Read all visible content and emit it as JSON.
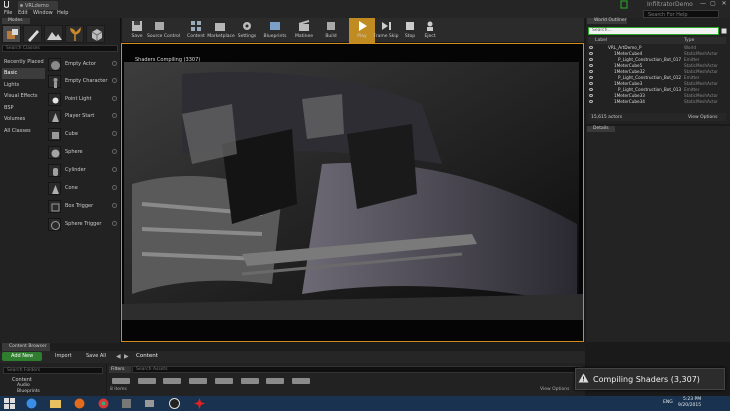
{
  "window": {
    "tab_label": "VRLdemo",
    "project_name": "InfiltratorDemo",
    "buttons": [
      "—",
      "▢",
      "✕"
    ]
  },
  "menu": {
    "items": [
      "File",
      "Edit",
      "Window",
      "Help"
    ],
    "search_help_placeholder": "Search For Help"
  },
  "modes": {
    "tab_label": "Modes",
    "search_placeholder": "Search Classes",
    "categories": [
      "Recently Placed",
      "Basic",
      "Lights",
      "Visual Effects",
      "BSP",
      "Volumes",
      "All Classes"
    ],
    "active_category": "Basic",
    "placeables": [
      "Empty Actor",
      "Empty Character",
      "Point Light",
      "Player Start",
      "Cube",
      "Sphere",
      "Cylinder",
      "Cone",
      "Box Trigger",
      "Sphere Trigger"
    ]
  },
  "toolbar": {
    "buttons": [
      "Save",
      "Source Control",
      "Content",
      "Marketplace",
      "Settings",
      "Blueprints",
      "Matinee",
      "Build",
      "Play",
      "Frame Skip",
      "Stop",
      "Eject"
    ]
  },
  "viewport": {
    "banner": "Shaders Compiling (3307)"
  },
  "outliner": {
    "tab_label": "World Outliner",
    "search_placeholder": "Search...",
    "col_label": "Label",
    "col_type": "Type",
    "rows": [
      {
        "name": "VRL_ArtDemo_P",
        "type": "World"
      },
      {
        "name": "1MeterCube4",
        "type": "StaticMeshActor"
      },
      {
        "name": "P_Light_Construction_Bot_017",
        "type": "Emitter"
      },
      {
        "name": "1MeterCube5",
        "type": "StaticMeshActor"
      },
      {
        "name": "1MeterCube32",
        "type": "StaticMeshActor"
      },
      {
        "name": "P_Light_Construction_Bot_012",
        "type": "Emitter"
      },
      {
        "name": "1MeterCube3",
        "type": "StaticMeshActor"
      },
      {
        "name": "P_Light_Construction_Bot_013",
        "type": "Emitter"
      },
      {
        "name": "1MeterCube33",
        "type": "StaticMeshActor"
      },
      {
        "name": "1MeterCube34",
        "type": "StaticMeshActor"
      }
    ],
    "actor_count": "15,615 actors",
    "view_options": "View Options"
  },
  "details": {
    "tab_label": "Details"
  },
  "content_browser": {
    "tab_label": "Content Browser",
    "add_new": "Add New",
    "import": "Import",
    "save_all": "Save All",
    "path": "Content",
    "search_folders_placeholder": "Search Folders",
    "tree": [
      "Content",
      "Audio",
      "Blueprints"
    ],
    "filters": "Filters",
    "search_assets_placeholder": "Search Assets",
    "items_count": "8 items",
    "view_options": "View Options"
  },
  "toast": {
    "text": "Compiling Shaders (3,307)"
  },
  "taskbar": {
    "language": "ENG",
    "time": "5:23 PM",
    "date": "9/20/2015"
  },
  "colors": {
    "accent_play": "#c08c22",
    "viewport_border": "#d28c1e",
    "add_new_green": "#2f7d2f",
    "taskbar": "#18324f"
  }
}
